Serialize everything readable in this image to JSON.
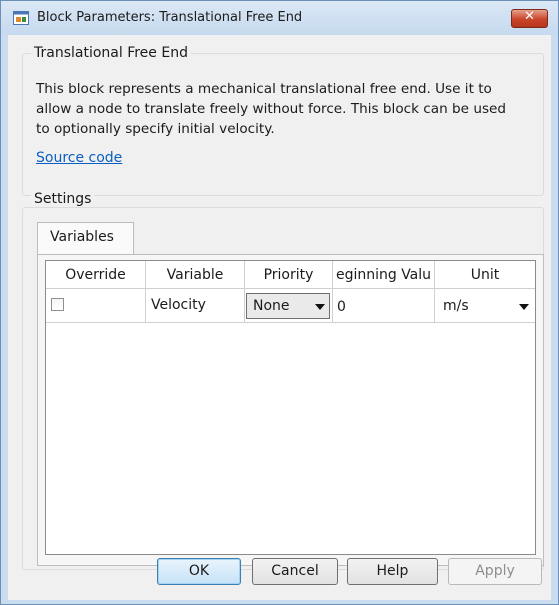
{
  "window": {
    "title": "Block Parameters: Translational Free End",
    "close_label": "✕"
  },
  "description": {
    "legend": "Translational Free End",
    "line1": "This block represents a mechanical translational free end. Use it to",
    "line2": "allow a node to translate freely without force. This block can be used",
    "line3": "to optionally specify initial velocity.",
    "source_link": "Source code"
  },
  "settings": {
    "legend": "Settings",
    "tabs": [
      {
        "label": "Variables",
        "selected": true
      }
    ],
    "table": {
      "headers": [
        "Override",
        "Variable",
        "Priority",
        "eginning Valu",
        "Unit"
      ],
      "rows": [
        {
          "override_checked": false,
          "variable": "Velocity",
          "priority": "None",
          "beginning_value": "0",
          "unit": "m/s"
        }
      ]
    }
  },
  "buttons": {
    "ok": "OK",
    "cancel": "Cancel",
    "help": "Help",
    "apply": "Apply"
  },
  "colors": {
    "title_bar": "#c6d9ee",
    "close_button": "#c9452a",
    "link": "#0b5fc2",
    "ok_button": "#c6e2f7"
  }
}
